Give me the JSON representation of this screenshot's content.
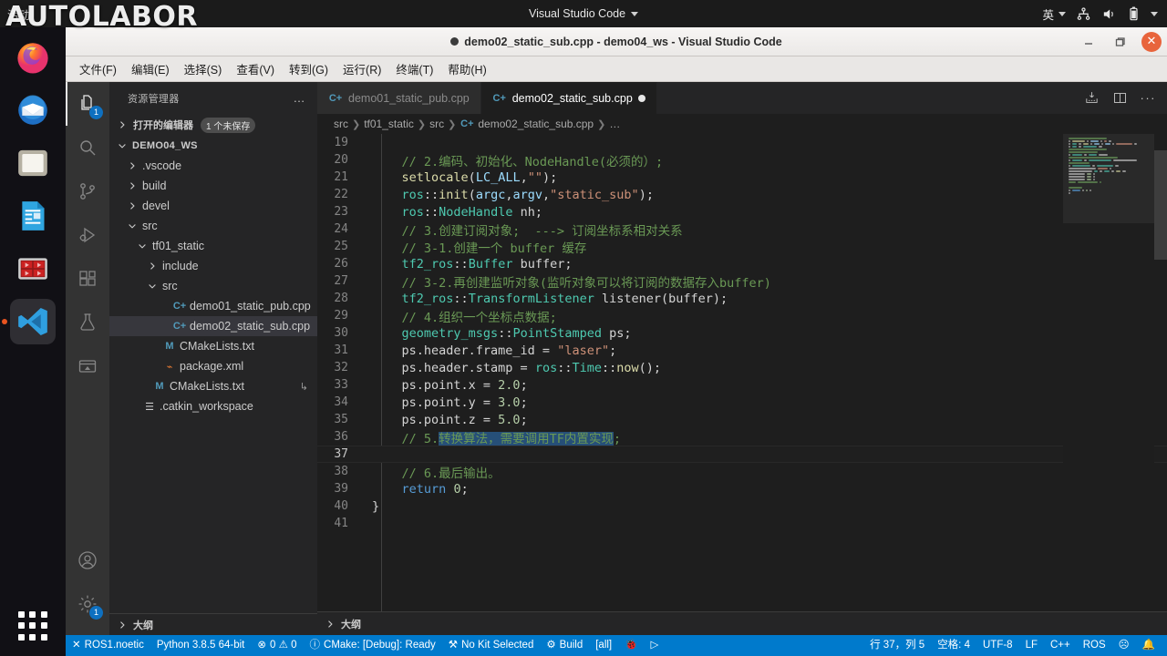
{
  "desktop": {
    "activities_label": "活动",
    "app_menu_label": "Visual Studio Code",
    "tray": {
      "input_method": "英"
    },
    "watermark": "AUTOLABOR",
    "dock_items": [
      {
        "name": "firefox",
        "label": "Firefox"
      },
      {
        "name": "thunderbird",
        "label": "Thunderbird Mail"
      },
      {
        "name": "files",
        "label": "Files"
      },
      {
        "name": "libreoffice-writer",
        "label": "LibreOffice Writer"
      },
      {
        "name": "rviz",
        "label": "RViz"
      },
      {
        "name": "vscode",
        "label": "Visual Studio Code"
      }
    ],
    "show_apps_label": "显示应用程序"
  },
  "window": {
    "title": "demo02_static_sub.cpp - demo04_ws - Visual Studio Code",
    "dirty": true,
    "controls": {
      "minimize": "—",
      "maximize": "▢",
      "close": "✕"
    }
  },
  "menubar": [
    {
      "label": "文件(F)"
    },
    {
      "label": "编辑(E)"
    },
    {
      "label": "选择(S)"
    },
    {
      "label": "查看(V)"
    },
    {
      "label": "转到(G)"
    },
    {
      "label": "运行(R)"
    },
    {
      "label": "终端(T)"
    },
    {
      "label": "帮助(H)"
    }
  ],
  "activitybar": {
    "items": [
      {
        "name": "explorer",
        "label": "资源管理器",
        "badge": "1",
        "active": true
      },
      {
        "name": "search",
        "label": "搜索",
        "badge": "",
        "active": false
      },
      {
        "name": "source-control",
        "label": "源代码管理",
        "badge": "",
        "active": false
      },
      {
        "name": "run-debug",
        "label": "运行和调试",
        "badge": "",
        "active": false
      },
      {
        "name": "extensions",
        "label": "扩展",
        "badge": "",
        "active": false
      },
      {
        "name": "testing",
        "label": "测试",
        "badge": "",
        "active": false
      },
      {
        "name": "remote-explorer",
        "label": "远程资源管理器",
        "badge": "",
        "active": false
      }
    ],
    "bottom": [
      {
        "name": "accounts",
        "label": "账户",
        "badge": ""
      },
      {
        "name": "settings",
        "label": "管理",
        "badge": "1"
      }
    ]
  },
  "sidebar": {
    "title": "资源管理器",
    "more_label": "…",
    "open_editors": {
      "label": "打开的编辑器",
      "badge": "1 个未保存"
    },
    "workspace_label": "DEMO04_WS",
    "tree": [
      {
        "label": ".vscode",
        "indent": 1,
        "kind": "folder",
        "expanded": false,
        "selected": false
      },
      {
        "label": "build",
        "indent": 1,
        "kind": "folder",
        "expanded": false,
        "selected": false
      },
      {
        "label": "devel",
        "indent": 1,
        "kind": "folder",
        "expanded": false,
        "selected": false
      },
      {
        "label": "src",
        "indent": 1,
        "kind": "folder",
        "expanded": true,
        "selected": false
      },
      {
        "label": "tf01_static",
        "indent": 2,
        "kind": "folder",
        "expanded": true,
        "selected": false
      },
      {
        "label": "include",
        "indent": 3,
        "kind": "folder",
        "expanded": false,
        "selected": false
      },
      {
        "label": "src",
        "indent": 3,
        "kind": "folder",
        "expanded": true,
        "selected": false
      },
      {
        "label": "demo01_static_pub.cpp",
        "indent": 4,
        "kind": "cpp",
        "expanded": false,
        "selected": false
      },
      {
        "label": "demo02_static_sub.cpp",
        "indent": 4,
        "kind": "cpp",
        "expanded": false,
        "selected": true
      },
      {
        "label": "CMakeLists.txt",
        "indent": 3,
        "kind": "md",
        "expanded": false,
        "selected": false
      },
      {
        "label": "package.xml",
        "indent": 3,
        "kind": "xml",
        "expanded": false,
        "selected": false
      },
      {
        "label": "CMakeLists.txt",
        "indent": 2,
        "kind": "md",
        "expanded": false,
        "selected": false,
        "trail": "↳"
      },
      {
        "label": ".catkin_workspace",
        "indent": 1,
        "kind": "txt",
        "expanded": false,
        "selected": false
      }
    ],
    "outline_label": "大纲"
  },
  "editor": {
    "tabs": [
      {
        "label": "demo01_static_pub.cpp",
        "active": false,
        "dirty": false
      },
      {
        "label": "demo02_static_sub.cpp",
        "active": true,
        "dirty": true
      }
    ],
    "tab_actions": [
      {
        "name": "run-code-icon",
        "label": "运行代码"
      },
      {
        "name": "split-editor-icon",
        "label": "拆分编辑器"
      },
      {
        "name": "more-actions-icon",
        "label": "更多操作"
      }
    ],
    "breadcrumbs": [
      "src",
      "tf01_static",
      "src",
      "demo02_static_sub.cpp",
      "…"
    ],
    "first_visible_line": 19,
    "current_line": 37,
    "lines": [
      {
        "n": 19,
        "tokens": []
      },
      {
        "n": 20,
        "tokens": [
          {
            "t": "    // 2.编码、初始化、NodeHandle(必须的）;",
            "c": "c-com"
          }
        ]
      },
      {
        "n": 21,
        "tokens": [
          {
            "t": "    ",
            "c": "c-punc"
          },
          {
            "t": "setlocale",
            "c": "c-fn"
          },
          {
            "t": "(",
            "c": "c-punc"
          },
          {
            "t": "LC_ALL",
            "c": "c-var"
          },
          {
            "t": ",",
            "c": "c-punc"
          },
          {
            "t": "\"\"",
            "c": "c-str"
          },
          {
            "t": ");",
            "c": "c-punc"
          }
        ]
      },
      {
        "n": 22,
        "tokens": [
          {
            "t": "    ",
            "c": "c-punc"
          },
          {
            "t": "ros",
            "c": "c-ns"
          },
          {
            "t": "::",
            "c": "c-punc"
          },
          {
            "t": "init",
            "c": "c-fn"
          },
          {
            "t": "(",
            "c": "c-punc"
          },
          {
            "t": "argc",
            "c": "c-var"
          },
          {
            "t": ",",
            "c": "c-punc"
          },
          {
            "t": "argv",
            "c": "c-var"
          },
          {
            "t": ",",
            "c": "c-punc"
          },
          {
            "t": "\"static_sub\"",
            "c": "c-str"
          },
          {
            "t": ");",
            "c": "c-punc"
          }
        ]
      },
      {
        "n": 23,
        "tokens": [
          {
            "t": "    ",
            "c": "c-punc"
          },
          {
            "t": "ros",
            "c": "c-ns"
          },
          {
            "t": "::",
            "c": "c-punc"
          },
          {
            "t": "NodeHandle",
            "c": "c-type"
          },
          {
            "t": " nh;",
            "c": "c-punc"
          }
        ]
      },
      {
        "n": 24,
        "tokens": [
          {
            "t": "    // 3.创建订阅对象;  ---> 订阅坐标系相对关系",
            "c": "c-com"
          }
        ]
      },
      {
        "n": 25,
        "tokens": [
          {
            "t": "    // 3-1.创建一个 buffer 缓存",
            "c": "c-com"
          }
        ]
      },
      {
        "n": 26,
        "tokens": [
          {
            "t": "    ",
            "c": "c-punc"
          },
          {
            "t": "tf2_ros",
            "c": "c-ns"
          },
          {
            "t": "::",
            "c": "c-punc"
          },
          {
            "t": "Buffer",
            "c": "c-type"
          },
          {
            "t": " buffer;",
            "c": "c-punc"
          }
        ]
      },
      {
        "n": 27,
        "tokens": [
          {
            "t": "    // 3-2.再创建监听对象(监听对象可以将订阅的数据存入buffer)",
            "c": "c-com"
          }
        ]
      },
      {
        "n": 28,
        "tokens": [
          {
            "t": "    ",
            "c": "c-punc"
          },
          {
            "t": "tf2_ros",
            "c": "c-ns"
          },
          {
            "t": "::",
            "c": "c-punc"
          },
          {
            "t": "TransformListener",
            "c": "c-type"
          },
          {
            "t": " listener(buffer);",
            "c": "c-punc"
          }
        ]
      },
      {
        "n": 29,
        "tokens": [
          {
            "t": "    // 4.组织一个坐标点数据;",
            "c": "c-com"
          }
        ]
      },
      {
        "n": 30,
        "tokens": [
          {
            "t": "    ",
            "c": "c-punc"
          },
          {
            "t": "geometry_msgs",
            "c": "c-ns"
          },
          {
            "t": "::",
            "c": "c-punc"
          },
          {
            "t": "PointStamped",
            "c": "c-type"
          },
          {
            "t": " ps;",
            "c": "c-punc"
          }
        ]
      },
      {
        "n": 31,
        "tokens": [
          {
            "t": "    ps.header.frame_id = ",
            "c": "c-punc"
          },
          {
            "t": "\"laser\"",
            "c": "c-str"
          },
          {
            "t": ";",
            "c": "c-punc"
          }
        ]
      },
      {
        "n": 32,
        "tokens": [
          {
            "t": "    ps.header.stamp = ",
            "c": "c-punc"
          },
          {
            "t": "ros",
            "c": "c-ns"
          },
          {
            "t": "::",
            "c": "c-punc"
          },
          {
            "t": "Time",
            "c": "c-type"
          },
          {
            "t": "::",
            "c": "c-punc"
          },
          {
            "t": "now",
            "c": "c-fn"
          },
          {
            "t": "();",
            "c": "c-punc"
          }
        ]
      },
      {
        "n": 33,
        "tokens": [
          {
            "t": "    ps.point.x = ",
            "c": "c-punc"
          },
          {
            "t": "2.0",
            "c": "c-num"
          },
          {
            "t": ";",
            "c": "c-punc"
          }
        ]
      },
      {
        "n": 34,
        "tokens": [
          {
            "t": "    ps.point.y = ",
            "c": "c-punc"
          },
          {
            "t": "3.0",
            "c": "c-num"
          },
          {
            "t": ";",
            "c": "c-punc"
          }
        ]
      },
      {
        "n": 35,
        "tokens": [
          {
            "t": "    ps.point.z = ",
            "c": "c-punc"
          },
          {
            "t": "5.0",
            "c": "c-num"
          },
          {
            "t": ";",
            "c": "c-punc"
          }
        ]
      },
      {
        "n": 36,
        "tokens": [
          {
            "t": "    // 5.",
            "c": "c-com"
          },
          {
            "t": "转换算法，需要调用TF内置实现",
            "c": "c-com",
            "sel": true
          },
          {
            "t": ";",
            "c": "c-com"
          }
        ]
      },
      {
        "n": 37,
        "tokens": []
      },
      {
        "n": 38,
        "tokens": [
          {
            "t": "    // 6.最后输出。",
            "c": "c-com"
          }
        ]
      },
      {
        "n": 39,
        "tokens": [
          {
            "t": "    ",
            "c": "c-punc"
          },
          {
            "t": "return",
            "c": "c-kw"
          },
          {
            "t": " ",
            "c": "c-punc"
          },
          {
            "t": "0",
            "c": "c-num"
          },
          {
            "t": ";",
            "c": "c-punc"
          }
        ]
      },
      {
        "n": 40,
        "tokens": [
          {
            "t": "}",
            "c": "c-punc"
          }
        ]
      },
      {
        "n": 41,
        "tokens": []
      }
    ]
  },
  "statusbar": {
    "left": [
      {
        "name": "remote-indicator",
        "icon": "✕",
        "label": "ROS1.noetic"
      },
      {
        "name": "python-version",
        "icon": "",
        "label": "Python 3.8.5 64-bit"
      },
      {
        "name": "problems",
        "icon": "⊗",
        "label": "0  ⚠ 0"
      },
      {
        "name": "cmake-status",
        "icon": "ⓘ",
        "label": "CMake: [Debug]: Ready"
      },
      {
        "name": "cmake-kit",
        "icon": "⚒",
        "label": "No Kit Selected"
      },
      {
        "name": "cmake-build",
        "icon": "⚙",
        "label": "Build"
      },
      {
        "name": "cmake-target",
        "icon": "",
        "label": "[all]"
      },
      {
        "name": "cmake-debug",
        "icon": "🐞",
        "label": ""
      },
      {
        "name": "cmake-run",
        "icon": "▷",
        "label": ""
      }
    ],
    "right": [
      {
        "name": "cursor-position",
        "label": "行 37，列 5"
      },
      {
        "name": "indentation",
        "label": "空格: 4"
      },
      {
        "name": "encoding",
        "label": "UTF-8"
      },
      {
        "name": "eol",
        "label": "LF"
      },
      {
        "name": "language-mode",
        "label": "C++"
      },
      {
        "name": "ros-distro",
        "label": "ROS"
      },
      {
        "name": "feedback-icon",
        "label": "☹"
      },
      {
        "name": "notifications-icon",
        "label": "🔔"
      }
    ]
  },
  "colors": {
    "accent": "#007acc",
    "editor_bg": "#1e1e1e",
    "sidebar_bg": "#252526",
    "activitybar_bg": "#333333",
    "badge": "#0e70c0",
    "selection": "#264f78",
    "comment": "#6a9955",
    "type": "#4ec9b0",
    "string": "#ce9178",
    "number": "#b5cea8",
    "keyword": "#569cd6",
    "close_button": "#e8643c"
  }
}
